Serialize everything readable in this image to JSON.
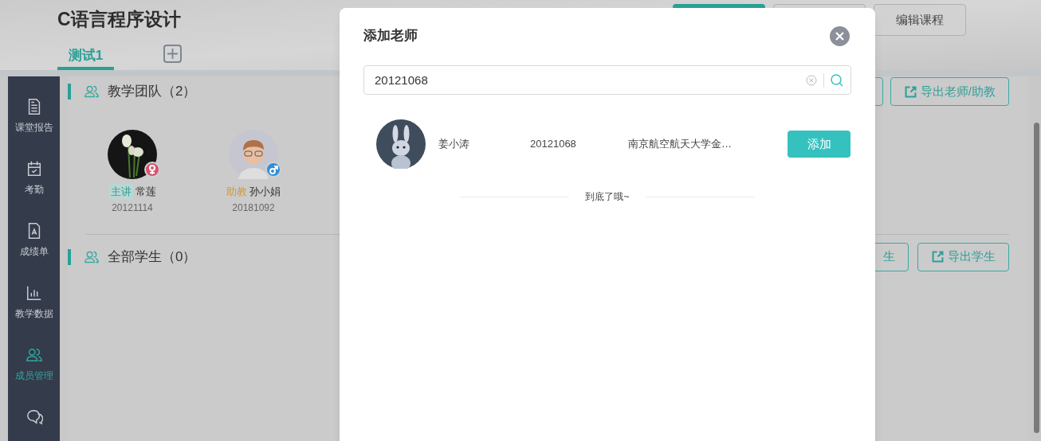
{
  "course": {
    "title": "C语言程序设计",
    "tabs": [
      {
        "label": "测试1",
        "selected": true
      }
    ],
    "header_buttons": [
      {
        "kind": "primary"
      },
      {
        "kind": "outline"
      },
      {
        "kind": "outline",
        "label": "编辑课程"
      }
    ]
  },
  "sidebar": {
    "items": [
      {
        "label": "课堂报告",
        "selected": false
      },
      {
        "label": "考勤",
        "selected": false
      },
      {
        "label": "成绩单",
        "selected": false
      },
      {
        "label": "教学数据",
        "selected": false
      },
      {
        "label": "成员管理",
        "selected": true
      },
      {
        "selected": false
      }
    ]
  },
  "team": {
    "title": "教学团队（2）",
    "buttons": [
      {
        "kind": "covered"
      },
      {
        "kind": "export",
        "label": "导出老师/助教"
      }
    ],
    "members": [
      {
        "role": "主讲",
        "kind": "lecturer",
        "name": "常莲",
        "id": "20121114"
      },
      {
        "role": "助教",
        "kind": "assistant",
        "name": "孙小娟",
        "id": "20181092"
      }
    ]
  },
  "students": {
    "title": "全部学生（0）",
    "buttons": [
      {
        "kind": "covered",
        "label": "生"
      },
      {
        "kind": "export",
        "label": "导出学生"
      }
    ]
  },
  "dialog": {
    "title": "添加老师",
    "search": {
      "value": "20121068"
    },
    "results": [
      {
        "name": "姜小涛",
        "id": "20121068",
        "school": "南京航空航天大学金…",
        "action": "添加"
      }
    ],
    "end_note": "到底了哦~"
  }
}
